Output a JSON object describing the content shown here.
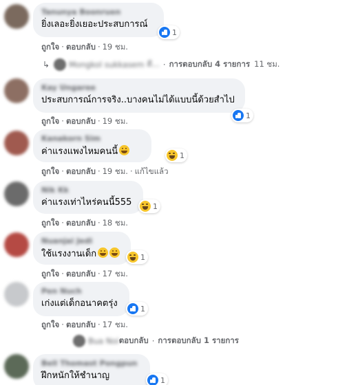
{
  "comments": [
    {
      "author": "Tanunya Boonruen",
      "text": "ยิ่งเลอะยิ่งเยอะประสบการณ์",
      "reaction": {
        "type": "like",
        "count": "1"
      },
      "actions": {
        "like": "ถูกใจ",
        "reply": "ตอบกลับ",
        "time": "19 ชม."
      },
      "replies_summary": {
        "preview_author": "Mongkol sukkasem",
        "preview_text": "ดี...",
        "label": "การตอบกลับ 4 รายการ",
        "time": "11 ชม."
      },
      "avatar_color": "#7b6a5e"
    },
    {
      "author": "Kay Ungaree",
      "text": "ประสบการณ์การจริง..บางคนไม่ได้แบบนี้ด้วยสำไป",
      "reaction": {
        "type": "like",
        "count": "1"
      },
      "actions": {
        "like": "ถูกใจ",
        "reply": "ตอบกลับ",
        "time": "19 ชม."
      },
      "avatar_color": "#8d6f63"
    },
    {
      "author": "Kanakorn Sim",
      "text": "ค่าแรงแพงไหมคนนี้",
      "reaction": {
        "type": "haha",
        "count": "1"
      },
      "actions": {
        "like": "ถูกใจ",
        "reply": "ตอบกลับ",
        "time": "19 ชม.",
        "edited": "แก้ไขแล้ว"
      },
      "avatar_color": "#a05a4f"
    },
    {
      "author": "Nik Kk",
      "text": "ค่าแรงเท่าไหร่คนนี้555",
      "reaction": {
        "type": "haha",
        "count": "1"
      },
      "actions": {
        "like": "ถูกใจ",
        "reply": "ตอบกลับ",
        "time": "18 ชม."
      },
      "avatar_color": "#6b6b6b"
    },
    {
      "author": "Nuanjai Jedi",
      "text": "ใช้แรงงานเด็ก",
      "reaction": {
        "type": "haha",
        "count": "1"
      },
      "actions": {
        "like": "ถูกใจ",
        "reply": "ตอบกลับ",
        "time": "17 ชม."
      },
      "avatar_color": "#b54a44"
    },
    {
      "author": "Pen Nuch",
      "text": "เก่งแต่เด็กอนาคตรุ่ง",
      "reaction": {
        "type": "like",
        "count": "1"
      },
      "actions": {
        "like": "ถูกใจ",
        "reply": "ตอบกลับ",
        "time": "17 ชม."
      },
      "replies_summary": {
        "preview_author": "Bua Noi",
        "label_prefix": "ตอบกลับ",
        "label": "การตอบกลับ 1 รายการ"
      },
      "avatar_color": "#c7c9cc"
    },
    {
      "author": "Bell Thomast Pongpun",
      "text": "ฝึกหนักให้ชำนาญ",
      "reaction": {
        "type": "like",
        "count": "1"
      },
      "avatar_color": "#5c6a58"
    }
  ]
}
